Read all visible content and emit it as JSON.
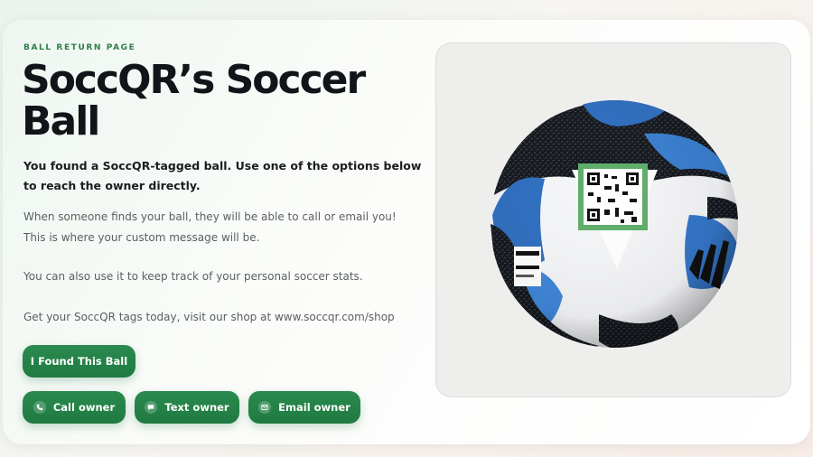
{
  "header": {
    "eyebrow": "BALL RETURN PAGE",
    "title": "SoccQR’s Soccer Ball"
  },
  "content": {
    "lead": "You found a SoccQR-tagged ball. Use one of the options below to reach the owner directly.",
    "paragraphs": [
      "When someone finds your ball, they will be able to call or email you! This is where your custom message will be.",
      "You can also use it to keep track of your personal soccer stats.",
      "Get your SoccQR tags today, visit our shop at www.soccqr.com/shop"
    ]
  },
  "actions": {
    "found_label": "I Found This Ball",
    "call_label": "Call owner",
    "text_label": "Text owner",
    "email_label": "Email owner"
  },
  "icons": {
    "call": "phone-icon",
    "text": "message-icon",
    "email": "mail-icon"
  },
  "colors": {
    "accent": "#1f7a42",
    "eyebrow": "#2f7d4a",
    "title": "#111418",
    "body_text": "#5a5f63"
  }
}
